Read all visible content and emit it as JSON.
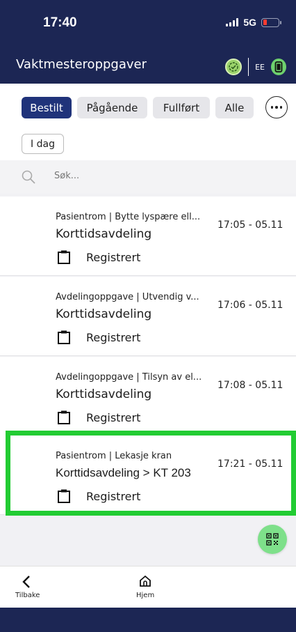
{
  "status_bar": {
    "time": "17:40",
    "network": "5G"
  },
  "header": {
    "title": "Vaktmesteroppgaver",
    "user_initials": "EE"
  },
  "filters": {
    "tabs": [
      {
        "label": "Bestilt",
        "active": true
      },
      {
        "label": "Pågående",
        "active": false
      },
      {
        "label": "Fullført",
        "active": false
      },
      {
        "label": "Alle",
        "active": false
      }
    ],
    "date_label": "I dag"
  },
  "search": {
    "placeholder": "Søk..."
  },
  "tasks": [
    {
      "category": "Pasientrom | Bytte lyspære ell...",
      "location": "Korttidsavdeling",
      "time": "17:05 - 05.11",
      "status": "Registrert"
    },
    {
      "category": "Avdelingoppgave | Utvendig v...",
      "location": "Korttidsavdeling",
      "time": "17:06 - 05.11",
      "status": "Registrert"
    },
    {
      "category": "Avdelingoppgave | Tilsyn av el...",
      "location": "Korttidsavdeling",
      "time": "17:08 - 05.11",
      "status": "Registrert"
    },
    {
      "category": "Pasientrom | Lekasje kran",
      "location": "Korttidsavdeling > KT 203",
      "time": "17:21 - 05.11",
      "status": "Registrert"
    }
  ],
  "bottom_nav": {
    "back_label": "Tilbake",
    "home_label": "Hjem"
  },
  "colors": {
    "header": "#1c2654",
    "active_chip": "#20337a",
    "highlight": "#22cc33",
    "fab": "#7ee08a"
  },
  "icons": [
    "search-icon",
    "clipboard-icon",
    "qr-code-icon",
    "chevron-left-icon",
    "home-icon",
    "sync-check-icon",
    "device-icon",
    "more-icon"
  ]
}
